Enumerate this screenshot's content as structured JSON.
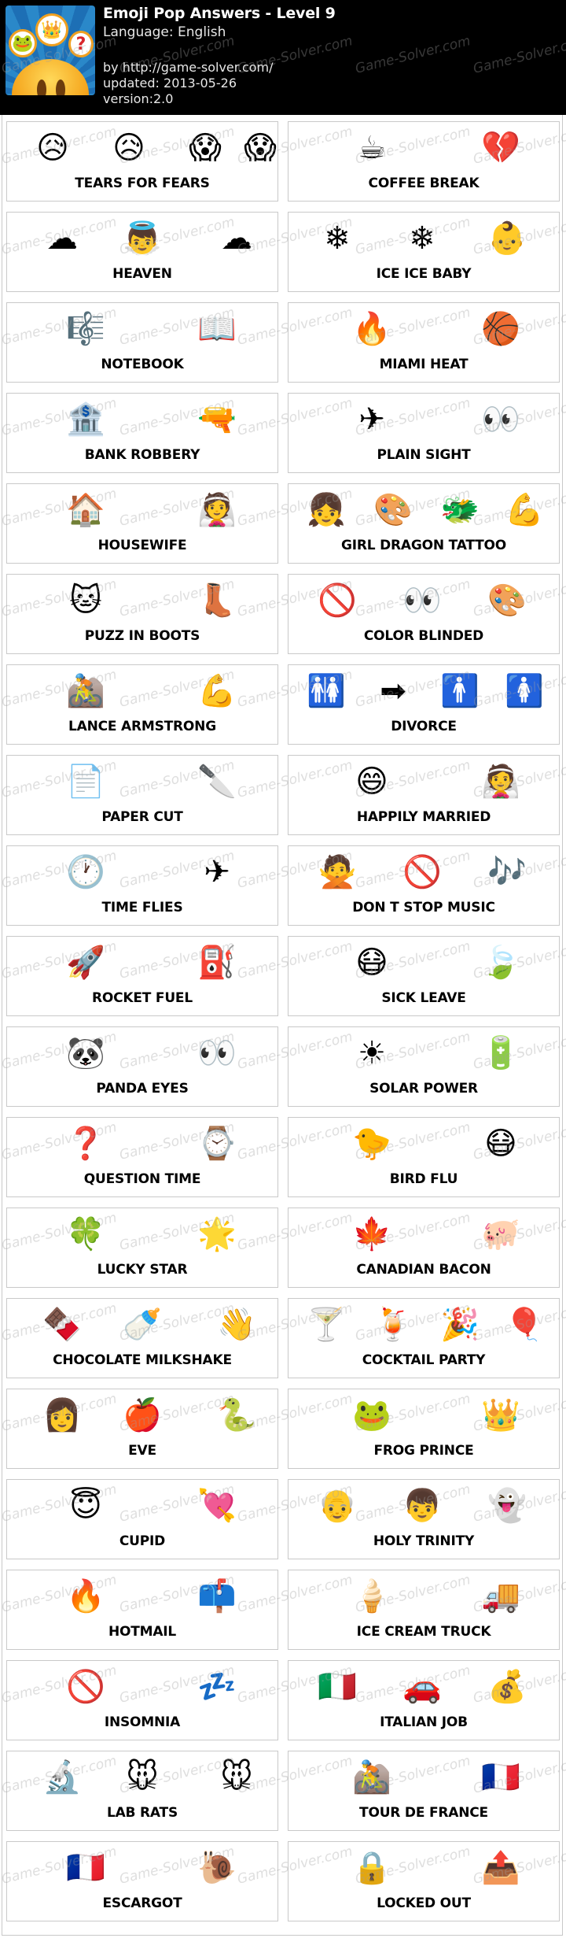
{
  "header": {
    "title": "Emoji Pop Answers - Level 9",
    "language": "Language: English",
    "by": "by http://game-solver.com/",
    "updated": "updated: 2013-05-26",
    "version": "version:2.0",
    "app_icon": "emoji-pop-app-icon",
    "icon_emojis": [
      "🐸",
      "👑",
      "?"
    ]
  },
  "watermark": "Game-Solver.com",
  "answers": [
    {
      "answer": "TEARS FOR FEARS",
      "emojis": [
        "😥",
        "😥",
        "😱",
        "😱"
      ],
      "icons": [
        "disappointed-relieved-icon",
        "disappointed-relieved-icon",
        "scream-icon",
        "scream-icon"
      ]
    },
    {
      "answer": "COFFEE BREAK",
      "emojis": [
        "☕",
        "💔"
      ],
      "icons": [
        "coffee-icon",
        "broken-heart-icon"
      ]
    },
    {
      "answer": "HEAVEN",
      "emojis": [
        "☁",
        "👼",
        "☁"
      ],
      "icons": [
        "cloud-icon",
        "angel-icon",
        "cloud-icon"
      ]
    },
    {
      "answer": "ICE ICE BABY",
      "emojis": [
        "❄",
        "❄",
        "👶"
      ],
      "icons": [
        "snowflake-icon",
        "snowflake-icon",
        "baby-icon"
      ]
    },
    {
      "answer": "NOTEBOOK",
      "emojis": [
        "🎼",
        "📖"
      ],
      "icons": [
        "musical-score-icon",
        "open-book-icon"
      ]
    },
    {
      "answer": "MIAMI HEAT",
      "emojis": [
        "🔥",
        "🏀"
      ],
      "icons": [
        "fire-icon",
        "basketball-icon"
      ]
    },
    {
      "answer": "BANK ROBBERY",
      "emojis": [
        "🏦",
        "🔫"
      ],
      "icons": [
        "bank-icon",
        "gun-icon"
      ]
    },
    {
      "answer": "PLAIN SIGHT",
      "emojis": [
        "✈",
        "👀"
      ],
      "icons": [
        "airplane-icon",
        "eyes-icon"
      ]
    },
    {
      "answer": "HOUSEWIFE",
      "emojis": [
        "🏠",
        "👰"
      ],
      "icons": [
        "house-icon",
        "bride-icon"
      ]
    },
    {
      "answer": "GIRL DRAGON TATTOO",
      "emojis": [
        "👧",
        "🎨",
        "🐲",
        "💪"
      ],
      "icons": [
        "girl-icon",
        "palette-icon",
        "dragon-face-icon",
        "muscle-icon"
      ]
    },
    {
      "answer": "PUZZ IN BOOTS",
      "emojis": [
        "🐱",
        "👢"
      ],
      "icons": [
        "cat-face-icon",
        "boot-icon"
      ]
    },
    {
      "answer": "COLOR BLINDED",
      "emojis": [
        "🚫",
        "👀",
        "🎨"
      ],
      "icons": [
        "no-entry-sign-icon",
        "eyes-icon",
        "palette-icon"
      ]
    },
    {
      "answer": "LANCE ARMSTRONG",
      "emojis": [
        "🚵",
        "💪"
      ],
      "icons": [
        "mountain-bicyclist-icon",
        "muscle-icon"
      ]
    },
    {
      "answer": "DIVORCE",
      "emojis": [
        "🚻",
        "➡",
        "🚹",
        "🚺"
      ],
      "icons": [
        "restroom-icon",
        "right-arrow-icon",
        "mens-icon",
        "womens-icon"
      ]
    },
    {
      "answer": "PAPER CUT",
      "emojis": [
        "📄",
        "🔪"
      ],
      "icons": [
        "page-icon",
        "knife-icon"
      ]
    },
    {
      "answer": "HAPPILY MARRIED",
      "emojis": [
        "😄",
        "👰"
      ],
      "icons": [
        "smile-icon",
        "bride-icon"
      ]
    },
    {
      "answer": "TIME FLIES",
      "emojis": [
        "🕐",
        "✈"
      ],
      "icons": [
        "clock-icon",
        "airplane-icon"
      ]
    },
    {
      "answer": "DON T STOP MUSIC",
      "emojis": [
        "🙅",
        "🚫",
        "🎶"
      ],
      "icons": [
        "no-good-gesture-icon",
        "no-entry-sign-icon",
        "music-notes-icon"
      ]
    },
    {
      "answer": "ROCKET FUEL",
      "emojis": [
        "🚀",
        "⛽"
      ],
      "icons": [
        "rocket-icon",
        "fuel-pump-icon"
      ]
    },
    {
      "answer": "SICK LEAVE",
      "emojis": [
        "😷",
        "🍃"
      ],
      "icons": [
        "mask-face-icon",
        "leaves-icon"
      ]
    },
    {
      "answer": "PANDA EYES",
      "emojis": [
        "🐼",
        "👀"
      ],
      "icons": [
        "panda-icon",
        "eyes-icon"
      ]
    },
    {
      "answer": "SOLAR POWER",
      "emojis": [
        "☀",
        "🔋"
      ],
      "icons": [
        "sun-icon",
        "battery-icon"
      ]
    },
    {
      "answer": "QUESTION TIME",
      "emojis": [
        "❓",
        "⌚"
      ],
      "icons": [
        "question-mark-icon",
        "watch-icon"
      ]
    },
    {
      "answer": "BIRD FLU",
      "emojis": [
        "🐤",
        "😷"
      ],
      "icons": [
        "chick-icon",
        "mask-face-icon"
      ]
    },
    {
      "answer": "LUCKY STAR",
      "emojis": [
        "🍀",
        "🌟"
      ],
      "icons": [
        "four-leaf-clover-icon",
        "glowing-star-icon"
      ]
    },
    {
      "answer": "CANADIAN BACON",
      "emojis": [
        "🍁",
        "🐖"
      ],
      "icons": [
        "maple-leaf-icon",
        "pig-icon"
      ]
    },
    {
      "answer": "CHOCOLATE MILKSHAKE",
      "emojis": [
        "🍫",
        "🍼",
        "👋"
      ],
      "icons": [
        "chocolate-bar-icon",
        "baby-bottle-icon",
        "waving-hand-icon"
      ]
    },
    {
      "answer": "COCKTAIL PARTY",
      "emojis": [
        "🍸",
        "🍹",
        "🎉",
        "🎈"
      ],
      "icons": [
        "cocktail-glass-icon",
        "tropical-drink-icon",
        "party-popper-icon",
        "balloon-icon"
      ]
    },
    {
      "answer": "EVE",
      "emojis": [
        "👩",
        "🍎",
        "🐍"
      ],
      "icons": [
        "woman-icon",
        "apple-icon",
        "snake-icon"
      ]
    },
    {
      "answer": "FROG PRINCE",
      "emojis": [
        "🐸",
        "👑"
      ],
      "icons": [
        "frog-icon",
        "crown-icon"
      ]
    },
    {
      "answer": "CUPID",
      "emojis": [
        "😇",
        "💘"
      ],
      "icons": [
        "halo-face-icon",
        "heart-arrow-icon"
      ]
    },
    {
      "answer": "HOLY TRINITY",
      "emojis": [
        "👴",
        "👦",
        "👻"
      ],
      "icons": [
        "old-man-icon",
        "boy-icon",
        "ghost-icon"
      ]
    },
    {
      "answer": "HOTMAIL",
      "emojis": [
        "🔥",
        "📫"
      ],
      "icons": [
        "fire-icon",
        "mailbox-icon"
      ]
    },
    {
      "answer": "ICE CREAM TRUCK",
      "emojis": [
        "🍦",
        "🚚"
      ],
      "icons": [
        "soft-ice-cream-icon",
        "delivery-truck-icon"
      ]
    },
    {
      "answer": "INSOMNIA",
      "emojis": [
        "🚫",
        "💤"
      ],
      "icons": [
        "no-entry-sign-icon",
        "zzz-icon"
      ]
    },
    {
      "answer": "ITALIAN JOB",
      "emojis": [
        "🇮🇹",
        "🚗",
        "💰"
      ],
      "icons": [
        "italy-flag-icon",
        "car-icon",
        "money-bag-icon"
      ]
    },
    {
      "answer": "LAB RATS",
      "emojis": [
        "🔬",
        "🐭",
        "🐭"
      ],
      "icons": [
        "microscope-icon",
        "mouse-face-icon",
        "mouse-face-icon"
      ]
    },
    {
      "answer": "TOUR DE FRANCE",
      "emojis": [
        "🚵",
        "🇫🇷"
      ],
      "icons": [
        "mountain-bicyclist-icon",
        "france-flag-icon"
      ]
    },
    {
      "answer": "ESCARGOT",
      "emojis": [
        "🇫🇷",
        "🐌"
      ],
      "icons": [
        "france-flag-icon",
        "snail-icon"
      ]
    },
    {
      "answer": "LOCKED OUT",
      "emojis": [
        "🔒",
        "📤"
      ],
      "icons": [
        "lock-icon",
        "outbox-tray-icon"
      ]
    }
  ]
}
